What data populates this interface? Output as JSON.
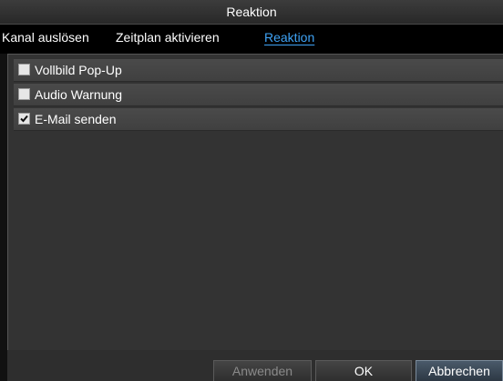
{
  "window": {
    "title": "Reaktion"
  },
  "tabs": [
    {
      "label": "Kanal auslösen",
      "active": false
    },
    {
      "label": "Zeitplan aktivieren",
      "active": false
    },
    {
      "label": "Reaktion",
      "active": true
    }
  ],
  "options": [
    {
      "label": "Vollbild Pop-Up",
      "checked": false
    },
    {
      "label": "Audio Warnung",
      "checked": false
    },
    {
      "label": "E-Mail senden",
      "checked": true
    }
  ],
  "buttons": {
    "apply_label": "Anwenden",
    "apply_enabled": false,
    "ok_label": "OK",
    "cancel_label": "Abbrechen"
  },
  "colors": {
    "active_tab": "#3fa3f5",
    "background": "#111111",
    "panel": "#333333"
  }
}
